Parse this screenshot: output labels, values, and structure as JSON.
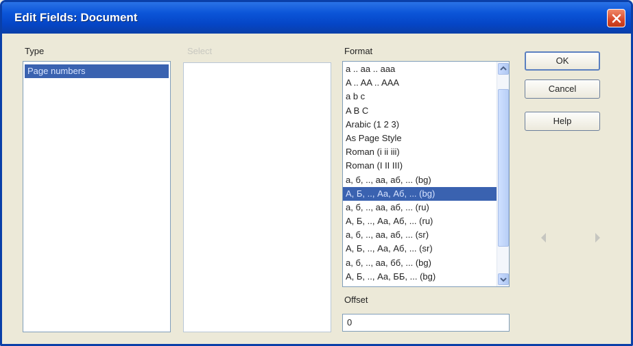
{
  "window": {
    "title": "Edit Fields: Document"
  },
  "type": {
    "label": "Type",
    "items": [
      "Page numbers"
    ]
  },
  "select": {
    "label": "Select"
  },
  "format": {
    "label": "Format",
    "items": [
      "a .. aa .. aaa",
      "A .. AA .. AAA",
      "a b c",
      "A B C",
      "Arabic (1 2 3)",
      "As Page Style",
      "Roman (i ii iii)",
      "Roman (I II III)",
      "а, б, .., аа, аб, ... (bg)",
      "А, Б, .., Аа, Аб, ... (bg)",
      "а, б, .., аа, аб, ... (ru)",
      "А, Б, .., Аа, Аб, ... (ru)",
      "а, б, .., аа, аб, ... (sr)",
      "А, Б, .., Аа, Аб, ... (sr)",
      "а, б, .., аа, бб, ... (bg)",
      "А, Б, .., Аа, ББ, ... (bg)"
    ],
    "selected_index": 9
  },
  "offset": {
    "label": "Offset",
    "value": "0"
  },
  "buttons": {
    "ok": "OK",
    "cancel": "Cancel",
    "help": "Help"
  },
  "icons": {
    "close": "close-icon",
    "prev": "arrow-left-icon",
    "next": "arrow-right-icon"
  },
  "colors": {
    "titlebar": "#0545c6",
    "selection": "#3a62b0"
  }
}
